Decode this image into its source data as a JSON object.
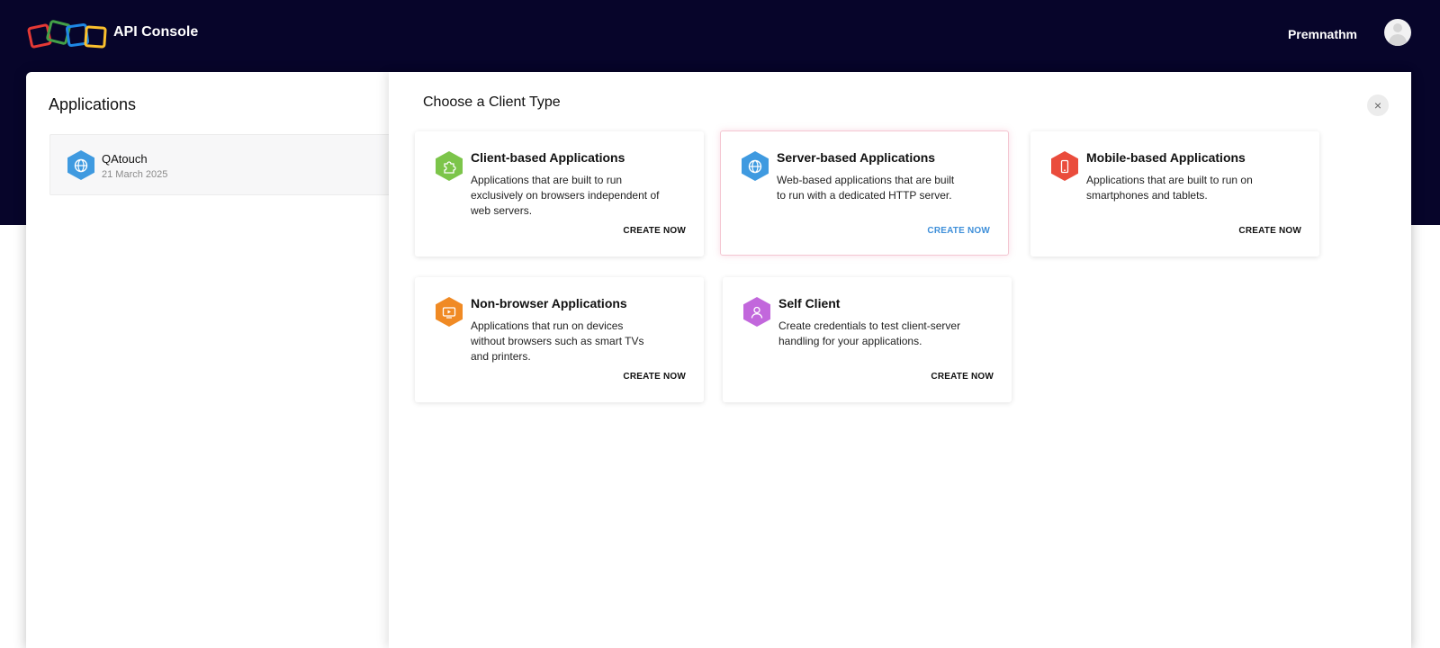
{
  "header": {
    "app_title": "API Console",
    "user_name": "Premnathm"
  },
  "applications": {
    "title": "Applications",
    "items": [
      {
        "name": "QAtouch",
        "date": "21 March 2025",
        "icon": "globe-icon"
      }
    ]
  },
  "panel": {
    "title": "Choose a Client Type",
    "close_label": "×",
    "cards": [
      {
        "title": "Client-based Applications",
        "desc": "Applications that are built to run exclusively on browsers independent of web servers.",
        "action": "CREATE NOW",
        "icon": "puzzle-icon",
        "color": "#7cc54a"
      },
      {
        "title": "Server-based Applications",
        "desc": "Web-based applications that are built to run with a dedicated HTTP server.",
        "action": "CREATE NOW",
        "icon": "globe-icon",
        "color": "#3f9ae0"
      },
      {
        "title": "Mobile-based Applications",
        "desc": "Applications that are built to run on smartphones and tablets.",
        "action": "CREATE NOW",
        "icon": "mobile-icon",
        "color": "#ea4c3c"
      },
      {
        "title": "Non-browser Applications",
        "desc": "Applications that run on devices without browsers such as smart TVs and printers.",
        "action": "CREATE NOW",
        "icon": "tv-icon",
        "color": "#f08a24"
      },
      {
        "title": "Self Client",
        "desc": "Create credentials to test client-server handling for your applications.",
        "action": "CREATE NOW",
        "icon": "user-icon",
        "color": "#c267dc"
      }
    ]
  },
  "colors": {
    "header_bg": "#07052a",
    "accent_link": "#3e8fd9"
  }
}
